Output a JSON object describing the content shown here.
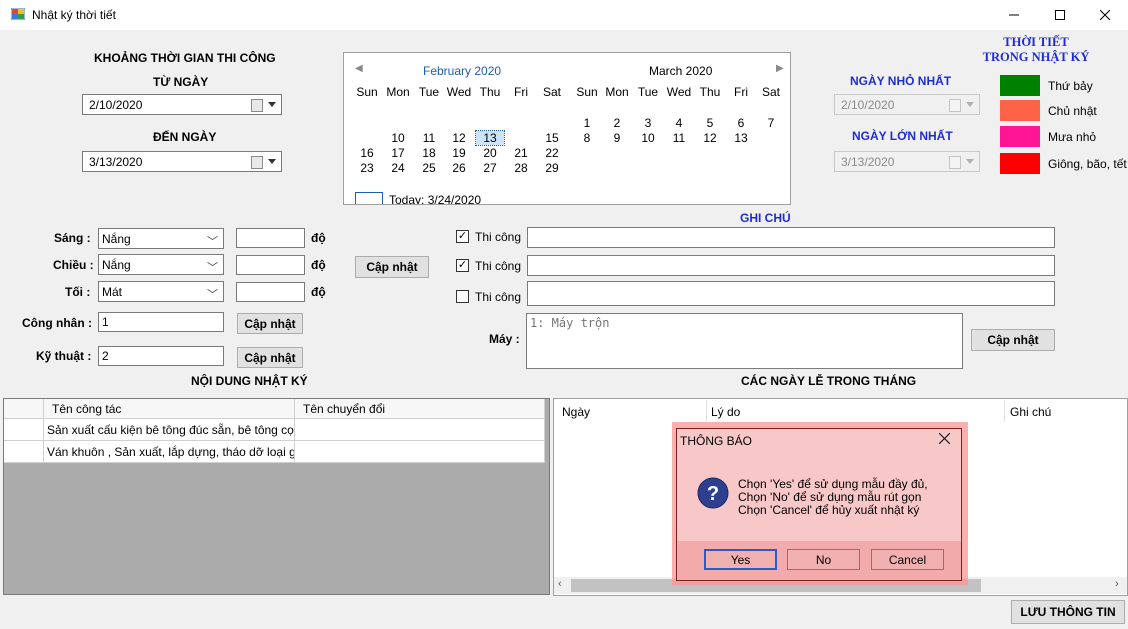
{
  "window": {
    "title": "Nhật ký thời tiết"
  },
  "period": {
    "heading": "KHOẢNG THỜI GIAN THI CÔNG",
    "from_label": "TỪ NGÀY",
    "from_value": "2/10/2020",
    "to_label": "ĐẾN NGÀY",
    "to_value": "3/13/2020"
  },
  "calendar": {
    "left_month": "February 2020",
    "right_month": "March 2020",
    "weekdays": [
      "Sun",
      "Mon",
      "Tue",
      "Wed",
      "Thu",
      "Fri",
      "Sat"
    ],
    "feb_days": [
      "10",
      "11",
      "12",
      "13",
      "15",
      "16",
      "17",
      "18",
      "19",
      "20",
      "21",
      "22",
      "23",
      "24",
      "25",
      "26",
      "27",
      "28",
      "29"
    ],
    "mar_days": [
      "1",
      "2",
      "3",
      "4",
      "5",
      "6",
      "7",
      "8",
      "9",
      "10",
      "11",
      "12",
      "13"
    ],
    "today": "Today: 3/24/2020"
  },
  "journal": {
    "min_label": "NGÀY NHỎ NHẤT",
    "min_value": "2/10/2020",
    "max_label": "NGÀY LỚN NHẤT",
    "max_value": "3/13/2020"
  },
  "legend": {
    "title": [
      "THỜI TIẾT",
      "TRONG NHẬT KÝ"
    ],
    "items": [
      {
        "label": "Thứ bảy",
        "color": "#008000"
      },
      {
        "label": "Chủ nhật",
        "color": "#ff6347"
      },
      {
        "label": "Mưa nhỏ",
        "color": "#ff1493"
      },
      {
        "label": "Giông, bão, tết",
        "color": "#ff0000"
      }
    ]
  },
  "weather": {
    "rows": [
      {
        "label": "Sáng :",
        "value": "Nắng",
        "unit": "độ"
      },
      {
        "label": "Chiều :",
        "value": "Nắng",
        "unit": "độ"
      },
      {
        "label": "Tối :",
        "value": "Mát",
        "unit": "độ"
      }
    ],
    "update_label": "Cập nhật"
  },
  "workers": {
    "workers_label": "Công nhân :",
    "workers_value": "1",
    "tech_label": "Kỹ thuật :",
    "tech_value": "2",
    "update_label": "Cập nhật"
  },
  "notes": {
    "heading": "GHI CHÚ",
    "rows": [
      {
        "label": "Thi công",
        "checked": true
      },
      {
        "label": "Thi công",
        "checked": true
      },
      {
        "label": "Thi công",
        "checked": false
      }
    ],
    "machine_label": "Máy :",
    "machine_placeholder": "1: Máy trộn",
    "update_label": "Cập nhật"
  },
  "content": {
    "heading": "NỘI DUNG NHẬT KÝ",
    "columns": [
      "Tên công tác",
      "Tên chuyển đổi"
    ],
    "rows": [
      [
        "Sản xuất cấu kiện bê tông đúc sẵn, bê tông cọc,...",
        ""
      ],
      [
        "Ván khuôn , Sản xuất, lắp dựng, tháo dỡ loại gỗ, ...",
        ""
      ]
    ]
  },
  "holidays": {
    "heading": "CÁC NGÀY LỄ TRONG THÁNG",
    "columns": [
      "Ngày",
      "Lý do",
      "Ghi chú"
    ]
  },
  "dialog": {
    "title": "THÔNG BÁO",
    "lines": [
      "Chọn 'Yes' để sử dụng mẫu đầy đủ,",
      "Chọn 'No' để sử dụng mẫu rút gọn",
      "Chọn 'Cancel' để hủy xuất nhật ký"
    ],
    "yes": "Yes",
    "no": "No",
    "cancel": "Cancel"
  },
  "save_label": "LƯU THÔNG TIN"
}
